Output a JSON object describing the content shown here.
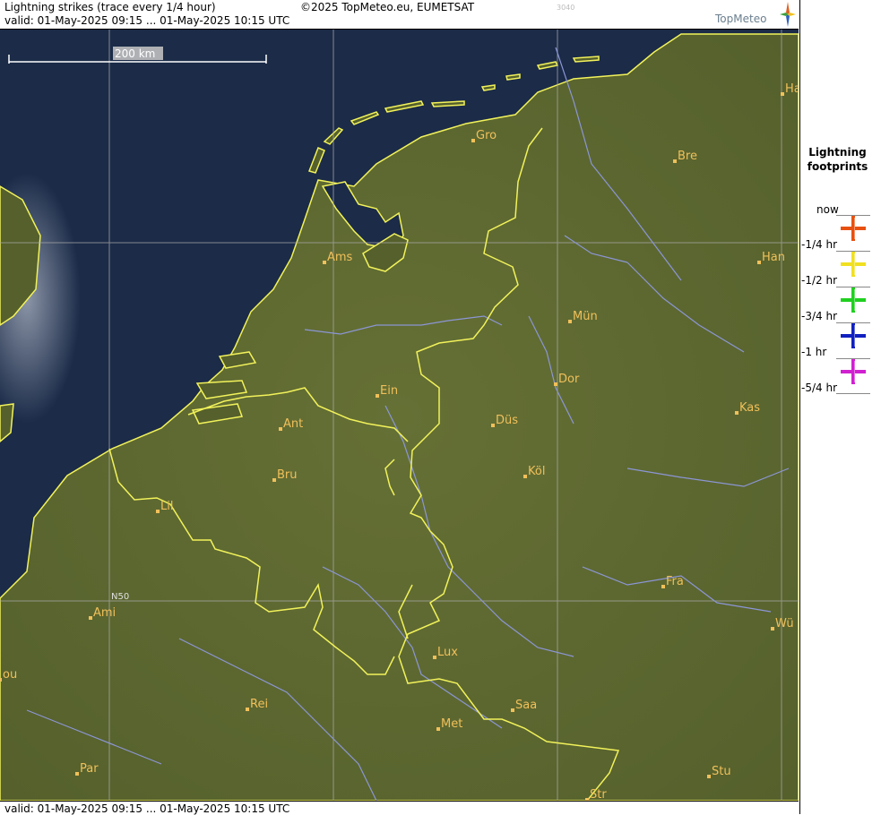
{
  "header": {
    "title": "Lightning strikes (trace every 1/4 hour)",
    "copyright": "©2025 TopMeteo.eu, EUMETSAT",
    "code": "3040",
    "valid": "valid:  01-May-2025 09:15 ... 01-May-2025 10:15 UTC"
  },
  "logo": {
    "text": "TopMeteo"
  },
  "footer": {
    "valid": "valid:  01-May-2025 09:15 ... 01-May-2025 10:15 UTC"
  },
  "map": {
    "scale_label": "200 km",
    "latitude_label": "N50",
    "cities": [
      {
        "name": "Gro"
      },
      {
        "name": "Bre"
      },
      {
        "name": "Ha"
      },
      {
        "name": "Ams"
      },
      {
        "name": "Han"
      },
      {
        "name": "Mün"
      },
      {
        "name": "Dor"
      },
      {
        "name": "Ein"
      },
      {
        "name": "Ant"
      },
      {
        "name": "Düs"
      },
      {
        "name": "Kas"
      },
      {
        "name": "Bru"
      },
      {
        "name": "Köl"
      },
      {
        "name": "Lil"
      },
      {
        "name": "Fra"
      },
      {
        "name": "Ami"
      },
      {
        "name": "Wü"
      },
      {
        "name": "Lux"
      },
      {
        "name": "ou"
      },
      {
        "name": "Rei"
      },
      {
        "name": "Saa"
      },
      {
        "name": "Met"
      },
      {
        "name": "Par"
      },
      {
        "name": "Stu"
      },
      {
        "name": "Str"
      }
    ]
  },
  "legend": {
    "title_line1": "Lightning",
    "title_line2": "footprints",
    "items": [
      {
        "label": "now",
        "color": "#e85010"
      },
      {
        "label": "-1/4 hr",
        "color": "#f0e020"
      },
      {
        "label": "-1/2 hr",
        "color": "#20d020"
      },
      {
        "label": "-3/4 hr",
        "color": "#1020c0"
      },
      {
        "label": "-1 hr",
        "color": "#d020d0"
      },
      {
        "label": "-5/4 hr",
        "color": ""
      }
    ]
  },
  "colors": {
    "sea": "#1a2a46",
    "land": "#5a6030",
    "border": "#f2f25a",
    "river": "#8c96d6",
    "grid": "#a0a0a0",
    "city": "#f0c05a"
  }
}
